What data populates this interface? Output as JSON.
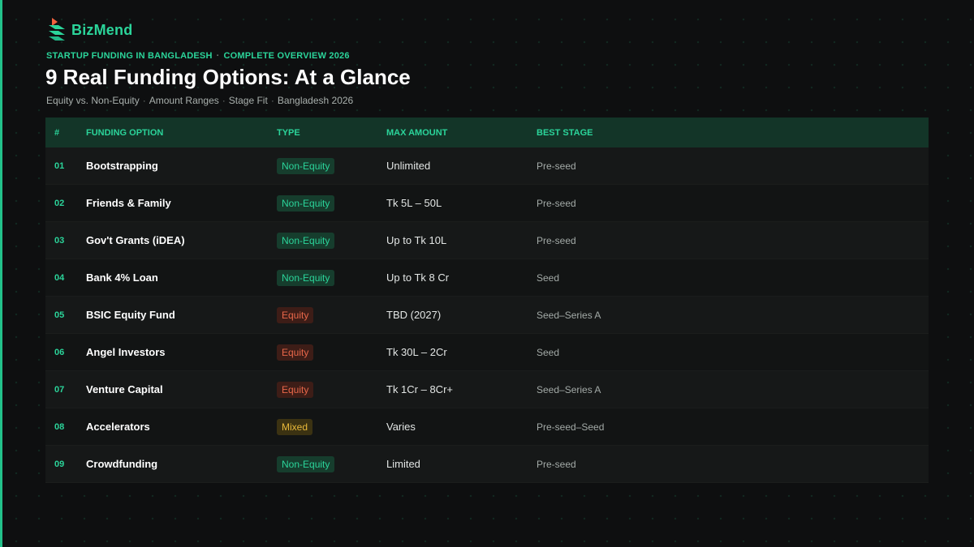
{
  "brand": {
    "name": "BizMend",
    "accent_color": "#2bd49a"
  },
  "header": {
    "eyebrow": [
      "STARTUP FUNDING IN BANGLADESH",
      "COMPLETE OVERVIEW 2026"
    ],
    "title": "9 Real Funding Options: At a Glance",
    "subtitle": [
      "Equity vs. Non-Equity",
      "Amount Ranges",
      "Stage Fit",
      "Bangladesh 2026"
    ]
  },
  "table": {
    "columns": [
      "#",
      "FUNDING OPTION",
      "TYPE",
      "MAX AMOUNT",
      "BEST STAGE"
    ],
    "rows": [
      {
        "num": "01",
        "option": "Bootstrapping",
        "type": "Non-Equity",
        "type_kind": "non-equity",
        "max": "Unlimited",
        "stage": "Pre-seed"
      },
      {
        "num": "02",
        "option": "Friends & Family",
        "type": "Non-Equity",
        "type_kind": "non-equity",
        "max": "Tk 5L – 50L",
        "stage": "Pre-seed"
      },
      {
        "num": "03",
        "option": "Gov't Grants (iDEA)",
        "type": "Non-Equity",
        "type_kind": "non-equity",
        "max": "Up to Tk 10L",
        "stage": "Pre-seed"
      },
      {
        "num": "04",
        "option": "Bank 4% Loan",
        "type": "Non-Equity",
        "type_kind": "non-equity",
        "max": "Up to Tk 8 Cr",
        "stage": "Seed"
      },
      {
        "num": "05",
        "option": "BSIC Equity Fund",
        "type": "Equity",
        "type_kind": "equity",
        "max": "TBD (2027)",
        "stage": "Seed–Series A"
      },
      {
        "num": "06",
        "option": "Angel Investors",
        "type": "Equity",
        "type_kind": "equity",
        "max": "Tk 30L – 2Cr",
        "stage": "Seed"
      },
      {
        "num": "07",
        "option": "Venture Capital",
        "type": "Equity",
        "type_kind": "equity",
        "max": "Tk 1Cr – 8Cr+",
        "stage": "Seed–Series A"
      },
      {
        "num": "08",
        "option": "Accelerators",
        "type": "Mixed",
        "type_kind": "mixed",
        "max": "Varies",
        "stage": "Pre-seed–Seed"
      },
      {
        "num": "09",
        "option": "Crowdfunding",
        "type": "Non-Equity",
        "type_kind": "non-equity",
        "max": "Limited",
        "stage": "Pre-seed"
      }
    ]
  },
  "type_colors": {
    "non-equity": "#2bd49a",
    "equity": "#e8674a",
    "mixed": "#e8b93a"
  }
}
